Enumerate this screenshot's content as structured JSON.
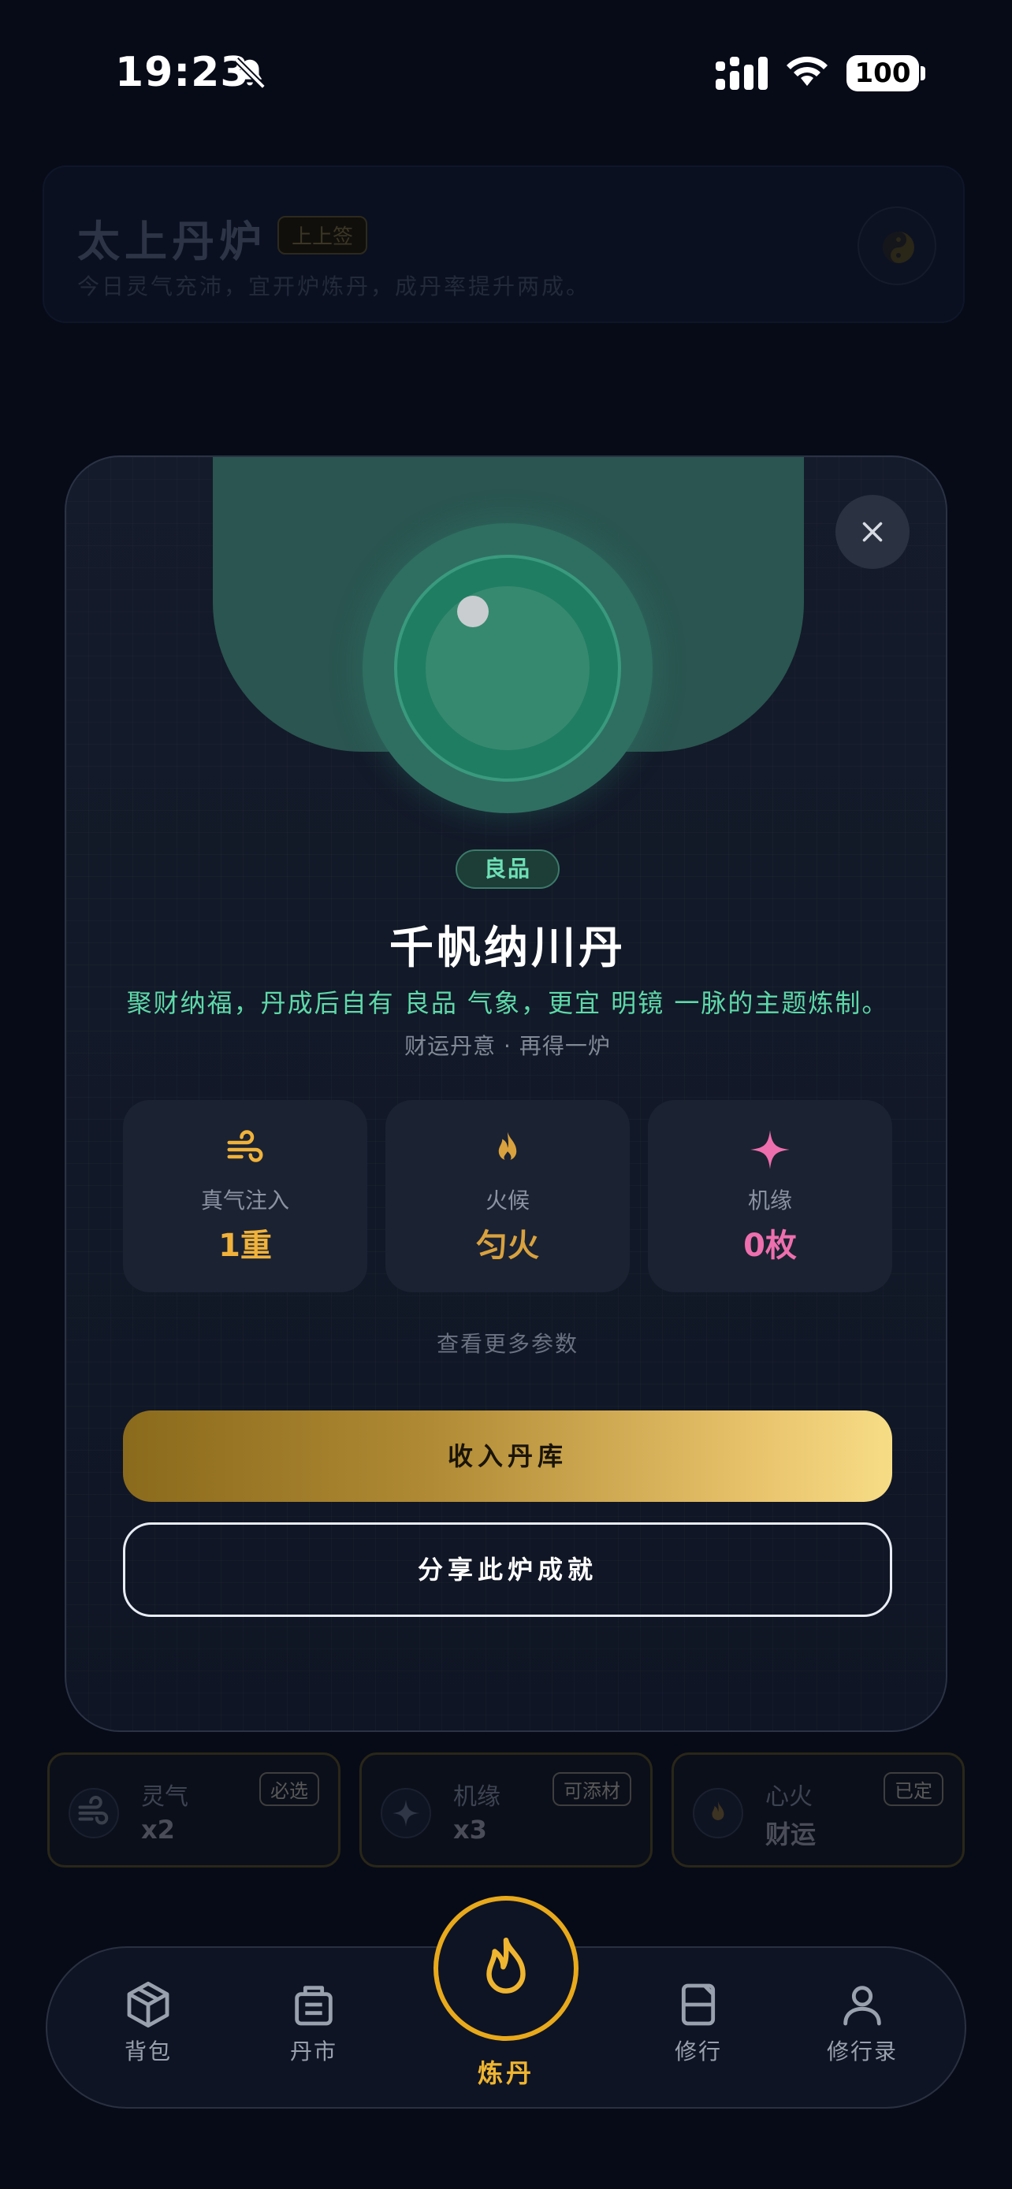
{
  "status_bar": {
    "time": "19:23",
    "battery": "100",
    "icons": [
      "bell-slash-icon",
      "signal-icon",
      "wifi-icon",
      "battery-icon"
    ]
  },
  "background_header": {
    "title": "太上丹炉",
    "sign": "上上签",
    "subtitle": "今日灵气充沛，宜开炉炼丹，成丹率提升两成。",
    "icon": "yin-yang-icon"
  },
  "modal": {
    "close_icon": "close-icon",
    "grade": "良品",
    "name": "千帆纳川丹",
    "description": "聚财纳福，丹成后自有 良品 气象，更宜 明镜 一脉的主题炼制。",
    "subtitle": "财运丹意 · 再得一炉",
    "stats": [
      {
        "icon": "wind-icon",
        "label": "真气注入",
        "value": "1重",
        "color": "#f0b23a"
      },
      {
        "icon": "flame-icon",
        "label": "火候",
        "value": "匀火",
        "color": "#d9a23e"
      },
      {
        "icon": "sparkle-icon",
        "label": "机缘",
        "value": "0枚",
        "color": "#ee6fae"
      }
    ],
    "more_link": "查看更多参数",
    "primary_button": "收入丹库",
    "secondary_button": "分享此炉成就"
  },
  "ingredients": [
    {
      "icon": "wind-icon",
      "label": "灵气",
      "value": "x2",
      "tag": "必选"
    },
    {
      "icon": "sparkle-icon",
      "label": "机缘",
      "value": "x3",
      "tag": "可添材"
    },
    {
      "icon": "flame-icon",
      "label": "心火",
      "value": "财运",
      "tag": "已定"
    }
  ],
  "tabbar": {
    "items": [
      {
        "icon": "box-icon",
        "label": "背包"
      },
      {
        "icon": "shop-icon",
        "label": "丹市"
      },
      {
        "icon": "flame-icon",
        "label": "炼丹",
        "active": true
      },
      {
        "icon": "book-icon",
        "label": "修行"
      },
      {
        "icon": "user-icon",
        "label": "修行录"
      }
    ],
    "accent": "#efb530"
  }
}
